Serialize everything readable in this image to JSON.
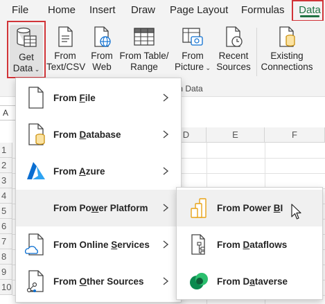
{
  "menubar": {
    "tabs": [
      {
        "label": "File"
      },
      {
        "label": "Home"
      },
      {
        "label": "Insert"
      },
      {
        "label": "Draw"
      },
      {
        "label": "Page Layout"
      },
      {
        "label": "Formulas"
      },
      {
        "label": "Data",
        "active": true
      }
    ]
  },
  "ribbon": {
    "buttons": [
      {
        "line1": "Get",
        "line2": "Data",
        "icon": "database-table-icon",
        "dropdown": true
      },
      {
        "line1": "From",
        "line2": "Text/CSV",
        "icon": "text-file-icon"
      },
      {
        "line1": "From",
        "line2": "Web",
        "icon": "web-page-icon"
      },
      {
        "line1": "From Table/",
        "line2": "Range",
        "icon": "table-grid-icon"
      },
      {
        "line1": "From",
        "line2": "Picture",
        "icon": "picture-camera-icon",
        "dropdown": true
      },
      {
        "line1": "Recent",
        "line2": "Sources",
        "icon": "recent-clock-icon"
      },
      {
        "line1": "Existing",
        "line2": "Connections",
        "icon": "connections-database-icon"
      }
    ],
    "group_label": "rm Data"
  },
  "sheet": {
    "namebox": "A",
    "columns": [
      "D",
      "E",
      "F"
    ],
    "rows": [
      "1",
      "2",
      "3",
      "4",
      "5",
      "6",
      "7",
      "8",
      "9",
      "10"
    ]
  },
  "menu": {
    "items": [
      {
        "pre": "From ",
        "key": "F",
        "post": "ile",
        "icon": "file-icon"
      },
      {
        "pre": "From ",
        "key": "D",
        "post": "atabase",
        "icon": "database-file-icon"
      },
      {
        "pre": "From ",
        "key": "A",
        "post": "zure",
        "icon": "azure-icon"
      },
      {
        "pre": "From Po",
        "key": "w",
        "post": "er Platform",
        "icon": "",
        "hover": true
      },
      {
        "pre": "From Online ",
        "key": "S",
        "post": "ervices",
        "icon": "cloud-file-icon"
      },
      {
        "pre": "From ",
        "key": "O",
        "post": "ther Sources",
        "icon": "other-sources-file-icon"
      }
    ]
  },
  "submenu": {
    "items": [
      {
        "pre": "From Power ",
        "key": "B",
        "post": "I",
        "icon": "power-bi-icon",
        "hover": true
      },
      {
        "pre": "From ",
        "key": "D",
        "post": "ataflows",
        "icon": "dataflows-icon"
      },
      {
        "pre": "From D",
        "key": "a",
        "post": "taverse",
        "icon": "dataverse-icon"
      }
    ]
  },
  "colors": {
    "accent": "#1f7244",
    "highlight_box": "#d13438",
    "azure": "#0a6ed1",
    "powerbi": "#e8a317",
    "dataverse": "#0b8a4f"
  }
}
